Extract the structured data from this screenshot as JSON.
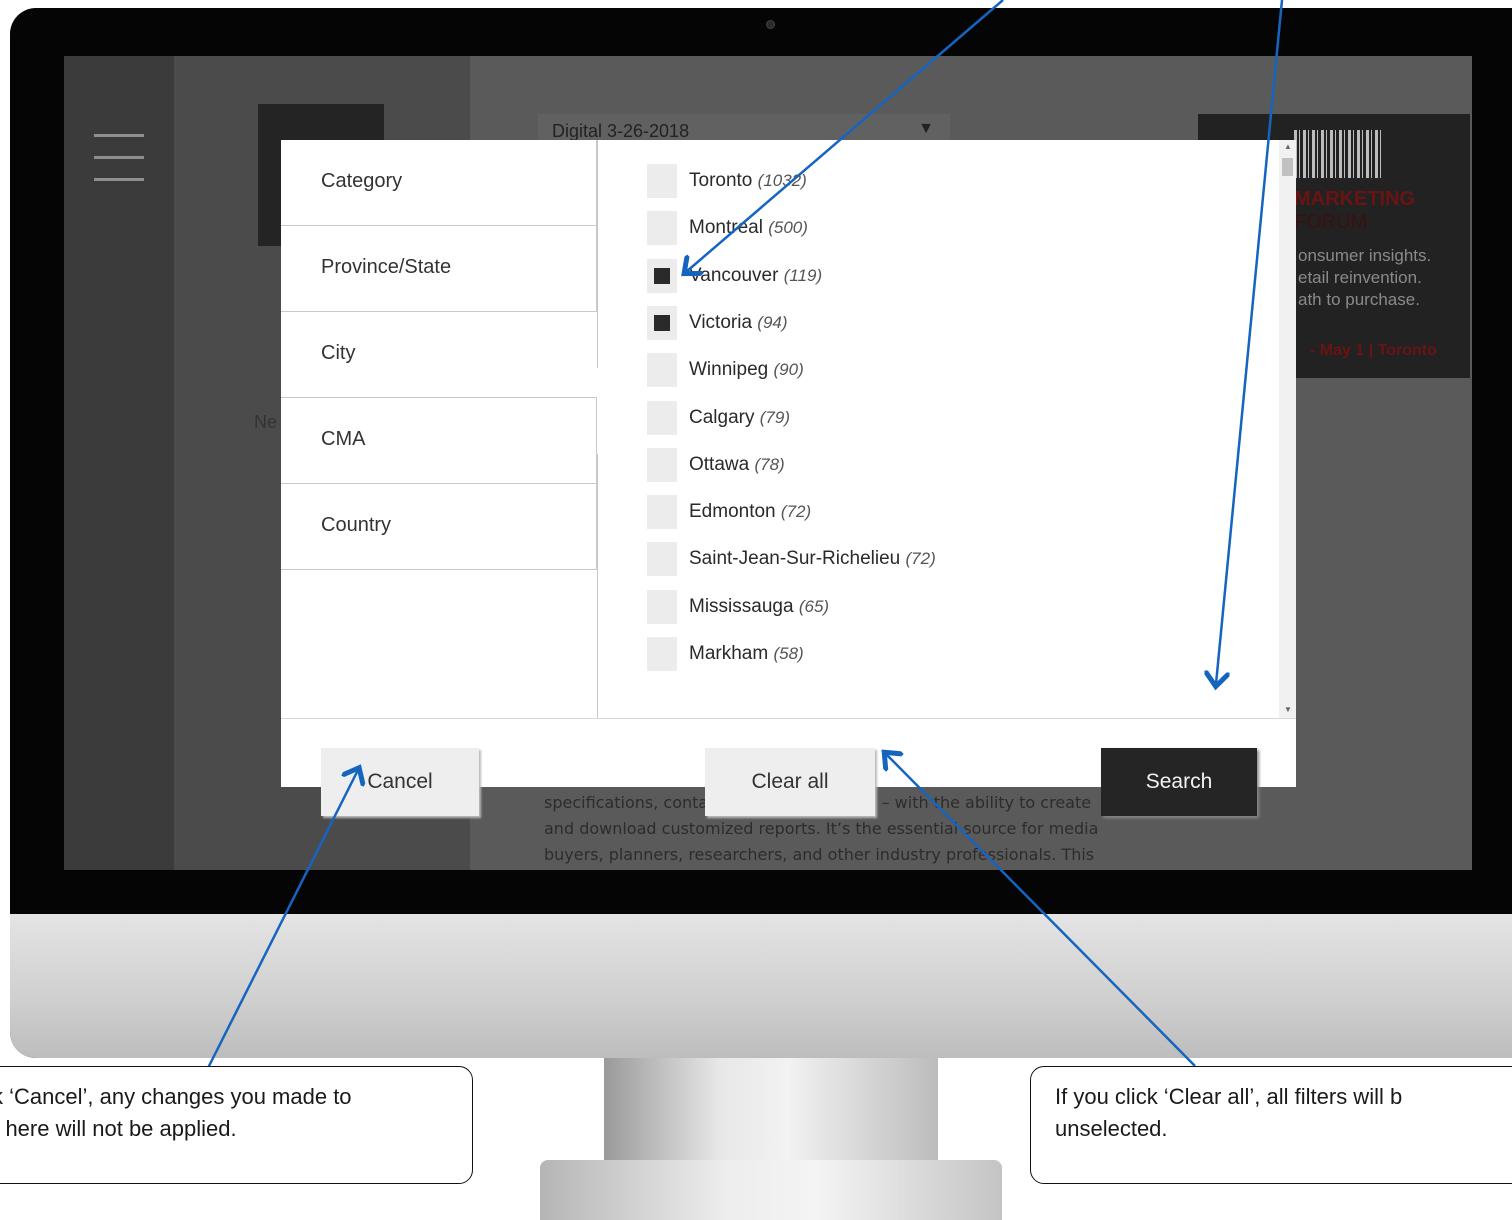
{
  "header": {
    "edition_select": "Digital 3-26-2018"
  },
  "background": {
    "left_partial_letter": "Ne",
    "ad": {
      "title_bold": "MARKETING",
      "title_thin": "FORUM",
      "lines": [
        "onsumer insights.",
        "etail reinvention.",
        "ath to purchase."
      ],
      "date_line": "- May 1 | Toronto"
    },
    "body_lines": [
      "specifications, contact details – and more – with the ability to create",
      "and download customized reports. It’s the essential source for media",
      "buyers, planners, researchers, and other industry professionals. This"
    ]
  },
  "filter_modal": {
    "tabs": [
      {
        "label": "Category",
        "active": false
      },
      {
        "label": "Province/State",
        "active": false
      },
      {
        "label": "City",
        "active": true
      },
      {
        "label": "CMA",
        "active": false
      },
      {
        "label": "Country",
        "active": false
      }
    ],
    "cities": [
      {
        "name": "Toronto",
        "count": "(1032)",
        "checked": false
      },
      {
        "name": "Montreal",
        "count": "(500)",
        "checked": false
      },
      {
        "name": "Vancouver",
        "count": "(119)",
        "checked": true
      },
      {
        "name": "Victoria",
        "count": "(94)",
        "checked": true
      },
      {
        "name": "Winnipeg",
        "count": "(90)",
        "checked": false
      },
      {
        "name": "Calgary",
        "count": "(79)",
        "checked": false
      },
      {
        "name": "Ottawa",
        "count": "(78)",
        "checked": false
      },
      {
        "name": "Edmonton",
        "count": "(72)",
        "checked": false
      },
      {
        "name": "Saint-Jean-Sur-Richelieu",
        "count": "(72)",
        "checked": false
      },
      {
        "name": "Mississauga",
        "count": "(65)",
        "checked": false
      },
      {
        "name": "Markham",
        "count": "(58)",
        "checked": false
      }
    ],
    "buttons": {
      "cancel": "Cancel",
      "clear_all": "Clear all",
      "search": "Search"
    }
  },
  "callouts": {
    "cancel_line1": "ck ‘Cancel’, any changes you made to",
    "cancel_line2": "rs here will not be applied.",
    "clear_line1": "If you click ‘Clear all’, all filters will b",
    "clear_line2": "unselected."
  },
  "colors": {
    "arrow": "#1565c0",
    "search_button": "#252525"
  }
}
